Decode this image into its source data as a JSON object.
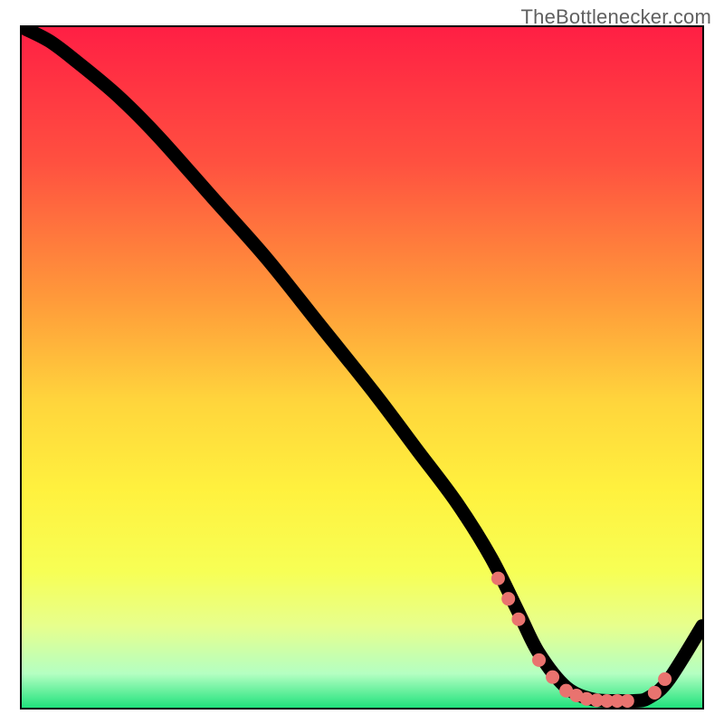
{
  "watermark": {
    "text": "TheBottlenecker.com"
  },
  "gradient": {
    "stops": [
      {
        "offset": 0.0,
        "color": "#ff1f44"
      },
      {
        "offset": 0.2,
        "color": "#ff5140"
      },
      {
        "offset": 0.4,
        "color": "#ff9a3a"
      },
      {
        "offset": 0.55,
        "color": "#ffd53c"
      },
      {
        "offset": 0.68,
        "color": "#fff13e"
      },
      {
        "offset": 0.8,
        "color": "#f7ff55"
      },
      {
        "offset": 0.88,
        "color": "#e7ff8d"
      },
      {
        "offset": 0.95,
        "color": "#b4ffc2"
      },
      {
        "offset": 1.0,
        "color": "#20e27c"
      }
    ]
  },
  "chart_data": {
    "type": "line",
    "title": "",
    "xlabel": "",
    "ylabel": "",
    "xlim": [
      0,
      100
    ],
    "ylim": [
      0,
      100
    ],
    "grid": false,
    "legend": false,
    "series": [
      {
        "name": "bottleneck-curve",
        "x": [
          0,
          4,
          8,
          14,
          20,
          28,
          36,
          44,
          52,
          58,
          64,
          69,
          73,
          76,
          80,
          84,
          88,
          90,
          92,
          95,
          100
        ],
        "y": [
          100,
          98,
          95,
          90,
          84,
          75,
          66,
          56,
          46,
          38,
          30,
          22,
          14,
          8,
          3,
          1.2,
          1.0,
          1.0,
          1.4,
          4,
          12
        ]
      }
    ],
    "markers": {
      "name": "highlight-points",
      "x": [
        70,
        71.5,
        73,
        76,
        78,
        80,
        81.5,
        83,
        84.5,
        86,
        87.5,
        89,
        93,
        94.5
      ],
      "y": [
        19,
        16,
        13,
        7,
        4.5,
        2.5,
        1.8,
        1.3,
        1.1,
        1.0,
        1.0,
        1.0,
        2.2,
        4.2
      ]
    }
  }
}
